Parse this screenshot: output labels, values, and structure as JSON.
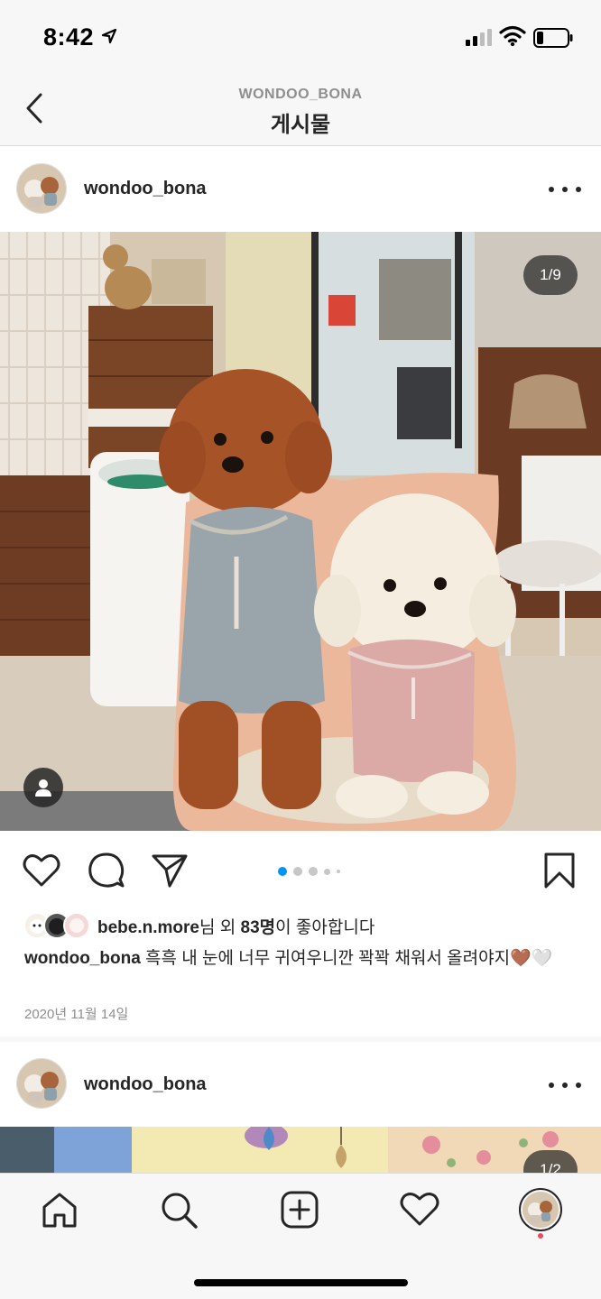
{
  "status_bar": {
    "time": "8:42"
  },
  "header": {
    "account": "WONDOO_BONA",
    "title": "게시물"
  },
  "posts": [
    {
      "username": "wondoo_bona",
      "image_counter": "1/9",
      "likes": {
        "liker": "bebe.n.more",
        "suffix_1": "님 외 ",
        "count": "83명",
        "suffix_2": "이 좋아합니다"
      },
      "caption": {
        "username": "wondoo_bona",
        "text": " 흑흑 내 눈에 너무 귀여우니깐 꽉꽉 채워서 올려야지🤎🤍"
      },
      "date": "2020년 11월 14일",
      "carousel": {
        "total_dots": 5,
        "active": 0
      }
    },
    {
      "username": "wondoo_bona",
      "image_counter": "1/2"
    }
  ],
  "icons": {
    "back": "chevron-left-icon",
    "like": "heart-icon",
    "comment": "comment-icon",
    "share": "paper-plane-icon",
    "save": "bookmark-icon",
    "tag": "person-icon",
    "more": "more-horizontal-icon"
  },
  "tabbar": [
    "home",
    "search",
    "new-post",
    "activity",
    "profile"
  ],
  "colors": {
    "accent": "#0095f6",
    "text": "#262626",
    "muted": "#8e8e8e",
    "notification": "#ed4956"
  }
}
